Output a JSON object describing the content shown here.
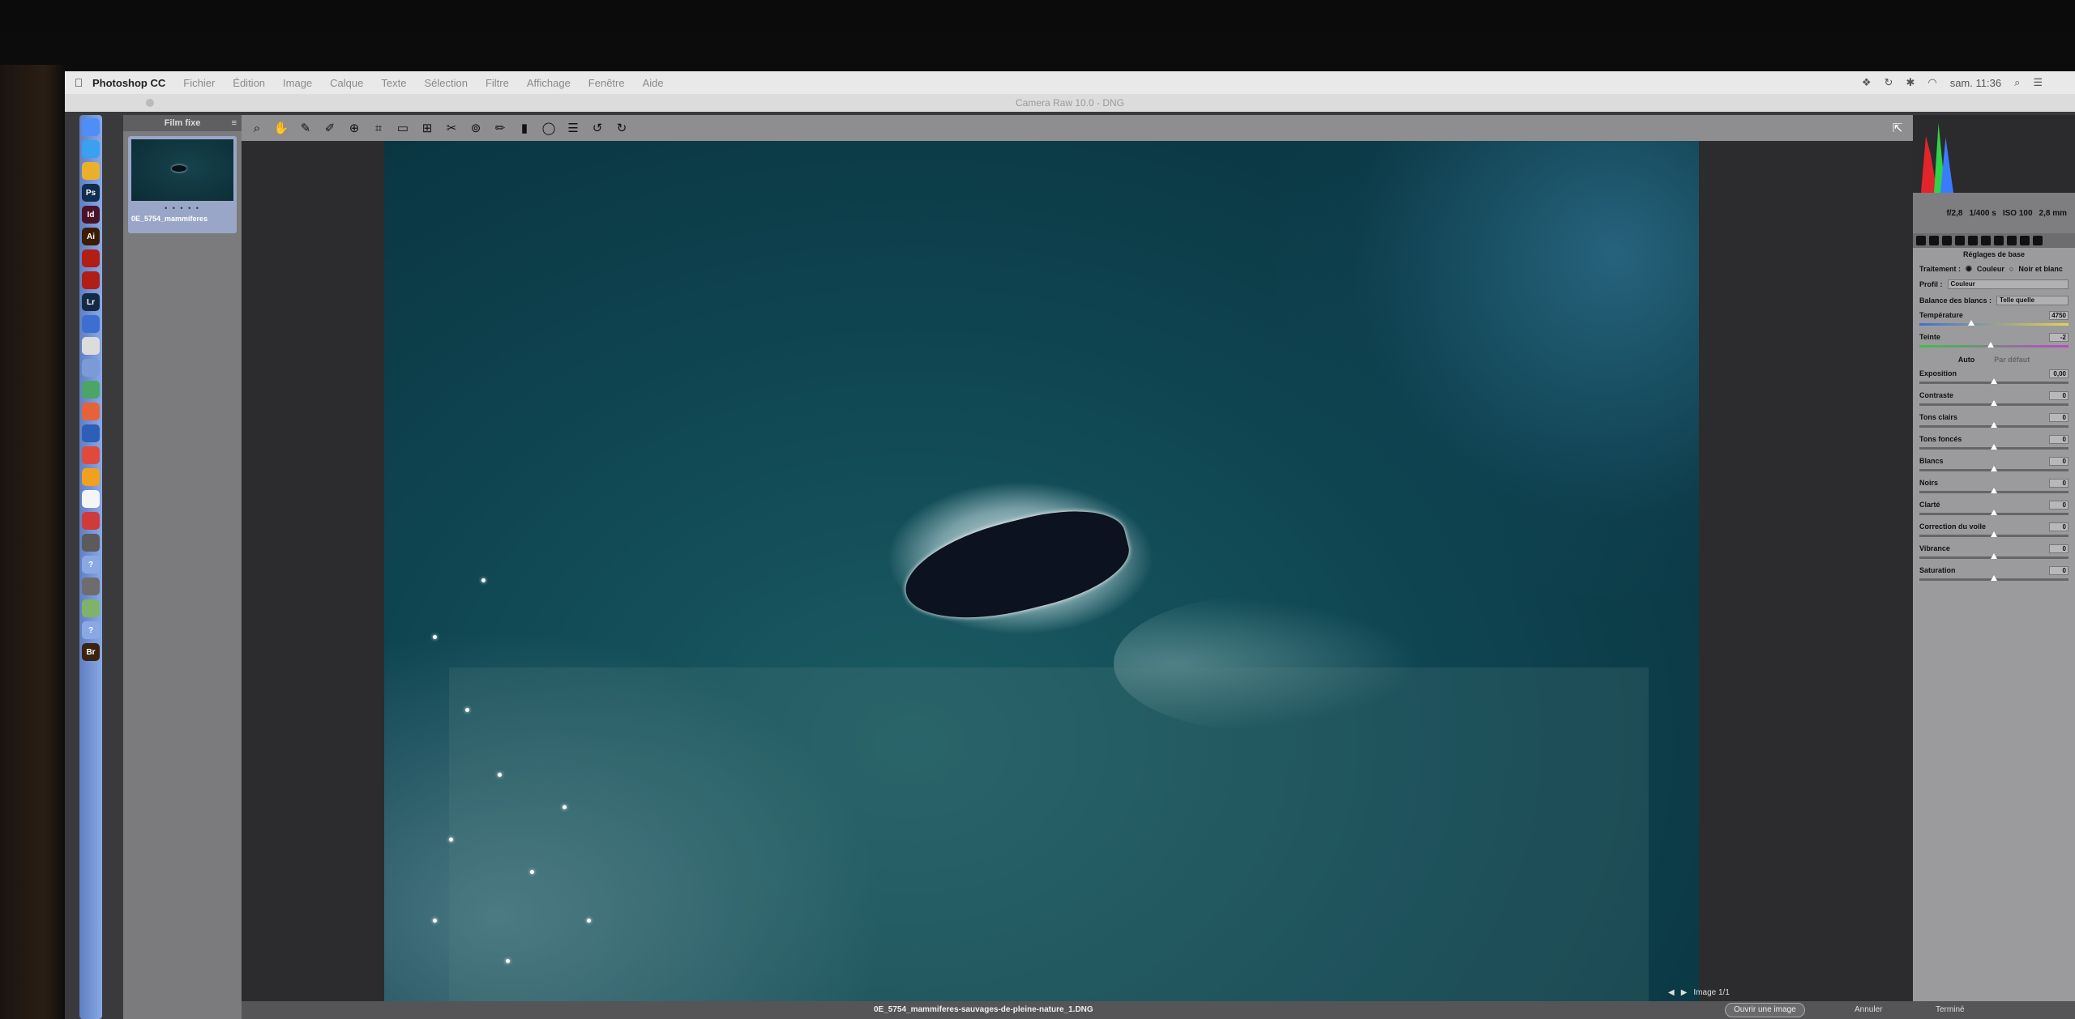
{
  "menubar": {
    "app_name": "Photoshop CC",
    "items": [
      "Fichier",
      "Édition",
      "Image",
      "Calque",
      "Texte",
      "Sélection",
      "Filtre",
      "Affichage",
      "Fenêtre",
      "Aide"
    ],
    "clock": "sam. 11:36"
  },
  "window": {
    "title": "Camera Raw 10.0 - DNG"
  },
  "dock": {
    "apps": [
      {
        "icon": "finder-icon",
        "label": "",
        "color": "#4f8ef7"
      },
      {
        "icon": "safari-icon",
        "label": "",
        "color": "#3aa0f0"
      },
      {
        "icon": "chrome-icon",
        "label": "",
        "color": "#e9b12b"
      },
      {
        "icon": "photoshop-icon",
        "label": "Ps",
        "color": "#0f2d4d"
      },
      {
        "icon": "indesign-icon",
        "label": "Id",
        "color": "#4a1227"
      },
      {
        "icon": "illustrator-icon",
        "label": "Ai",
        "color": "#3b1c02"
      },
      {
        "icon": "acrobat-icon",
        "label": "",
        "color": "#b01e16"
      },
      {
        "icon": "acrobat-reader-icon",
        "label": "",
        "color": "#b01e16"
      },
      {
        "icon": "lightroom-icon",
        "label": "Lr",
        "color": "#132a44"
      },
      {
        "icon": "app-icon",
        "label": "",
        "color": "#3d6fd1"
      },
      {
        "icon": "app-icon",
        "label": "",
        "color": "#dcdcdc"
      },
      {
        "icon": "app-icon",
        "label": "",
        "color": "#7a9bd8"
      },
      {
        "icon": "app-icon",
        "label": "",
        "color": "#4aa567"
      },
      {
        "icon": "app-icon",
        "label": "",
        "color": "#e6623a"
      },
      {
        "icon": "app-icon",
        "label": "",
        "color": "#2d5fb8"
      },
      {
        "icon": "app-icon",
        "label": "",
        "color": "#e04a3c"
      },
      {
        "icon": "app-icon",
        "label": "",
        "color": "#f1a020"
      },
      {
        "icon": "app-icon",
        "label": "",
        "color": "#f5f5f5"
      },
      {
        "icon": "app-icon",
        "label": "",
        "color": "#cf3b3b"
      },
      {
        "icon": "app-icon",
        "label": "",
        "color": "#5b5b5b"
      },
      {
        "icon": "help-icon",
        "label": "?",
        "color": "#8aa8e6"
      },
      {
        "icon": "app-icon",
        "label": "",
        "color": "#6d6d6d"
      },
      {
        "icon": "app-icon",
        "label": "",
        "color": "#7fb36a"
      },
      {
        "icon": "help-icon",
        "label": "?",
        "color": "#8aa8e6"
      },
      {
        "icon": "bridge-icon",
        "label": "Br",
        "color": "#3a2410"
      }
    ]
  },
  "filmstrip": {
    "header": "Film fixe",
    "thumb_filename": "0E_5754_mammiferes",
    "stars": "• • • • •"
  },
  "toolbar": {
    "tools": [
      "zoom-icon",
      "hand-icon",
      "eyedropper-icon",
      "color-sampler-icon",
      "target-adjust-icon",
      "crop-icon",
      "straighten-icon",
      "transform-icon",
      "spot-removal-icon",
      "red-eye-icon",
      "adjustment-brush-icon",
      "graduated-filter-icon",
      "radial-filter-icon",
      "preferences-icon",
      "rotate-left-icon",
      "rotate-right-icon"
    ]
  },
  "canvas": {
    "caption": "0E_5754_mammiferes-sauvages-de-pleine-nature_1.DNG"
  },
  "navigation": {
    "image_counter": "Image 1/1"
  },
  "buttons": {
    "open": "Ouvrir une image",
    "cancel": "Annuler",
    "done": "Terminé"
  },
  "exif": {
    "aperture": "f/2,8",
    "shutter": "1/400 s",
    "iso": "ISO 100",
    "focal": "2,8 mm"
  },
  "panel": {
    "title": "Réglages de base",
    "treatment_label": "Traitement :",
    "treatment_color": "Couleur",
    "treatment_bw": "Noir et blanc",
    "profile_label": "Profil :",
    "profile_value": "Couleur",
    "wb_label": "Balance des blancs :",
    "wb_value": "Telle quelle",
    "tone_auto": "Auto",
    "tone_default": "Par défaut",
    "sliders": [
      {
        "label": "Température",
        "value": "4750",
        "pos": 0.35,
        "track": "temp"
      },
      {
        "label": "Teinte",
        "value": "-2",
        "pos": 0.48,
        "track": "tint"
      },
      {
        "label": "Exposition",
        "value": "0,00",
        "pos": 0.5,
        "track": ""
      },
      {
        "label": "Contraste",
        "value": "0",
        "pos": 0.5,
        "track": ""
      },
      {
        "label": "Tons clairs",
        "value": "0",
        "pos": 0.5,
        "track": ""
      },
      {
        "label": "Tons foncés",
        "value": "0",
        "pos": 0.5,
        "track": ""
      },
      {
        "label": "Blancs",
        "value": "0",
        "pos": 0.5,
        "track": ""
      },
      {
        "label": "Noirs",
        "value": "0",
        "pos": 0.5,
        "track": ""
      },
      {
        "label": "Clarté",
        "value": "0",
        "pos": 0.5,
        "track": ""
      },
      {
        "label": "Correction du voile",
        "value": "0",
        "pos": 0.5,
        "track": ""
      },
      {
        "label": "Vibrance",
        "value": "0",
        "pos": 0.5,
        "track": ""
      },
      {
        "label": "Saturation",
        "value": "0",
        "pos": 0.5,
        "track": ""
      }
    ]
  }
}
